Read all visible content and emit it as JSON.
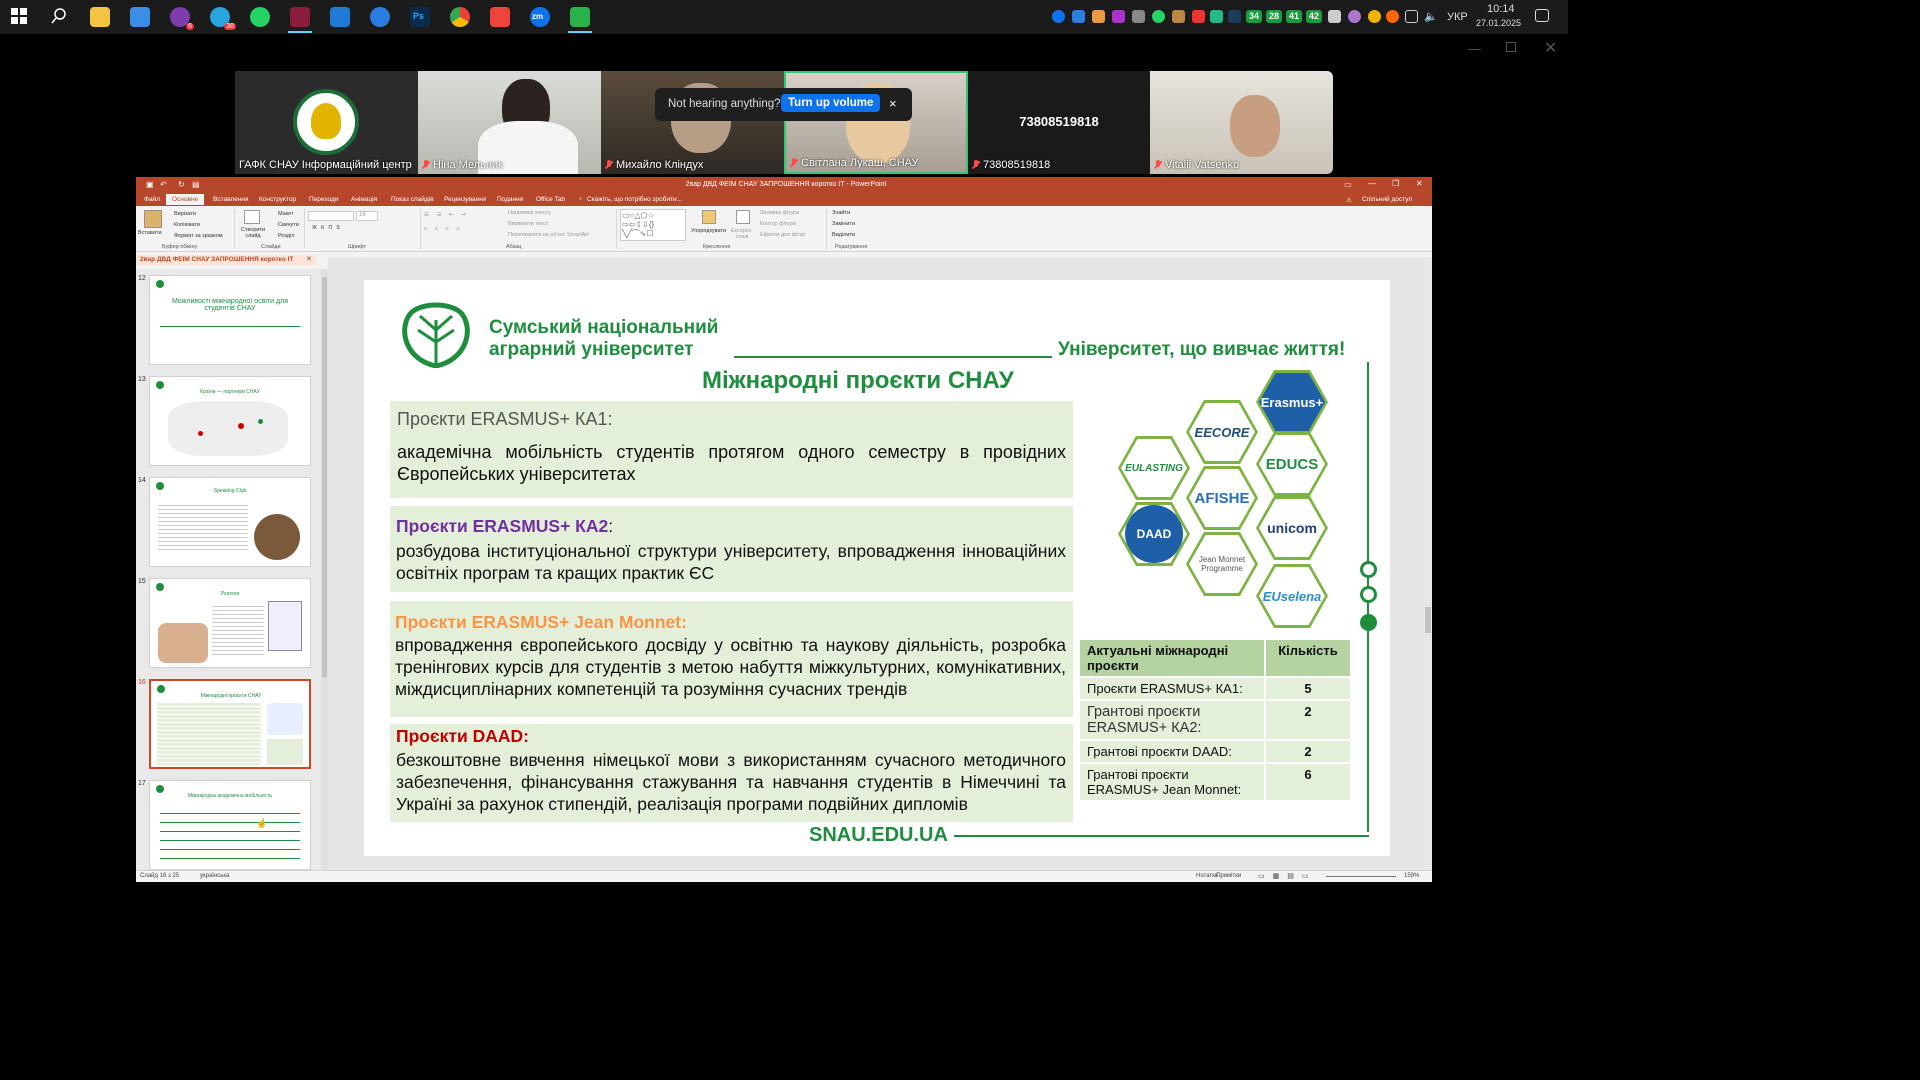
{
  "taskbar": {
    "icons": [
      "windows-icon",
      "search-icon",
      "file-explorer-icon",
      "microsoft-store-icon",
      "viber-icon",
      "telegram-icon",
      "whatsapp-icon",
      "app-icon",
      "vscode-icon",
      "firefox-icon",
      "photoshop-icon",
      "chrome-icon",
      "anydesk-icon",
      "zoom-icon",
      "app-green-icon"
    ],
    "badges": {
      "viber": "6",
      "telegram": "38"
    },
    "tray_numbers": [
      "34",
      "28",
      "41",
      "42"
    ],
    "language": "УКР",
    "time": "10:14",
    "date": "27.01.2025"
  },
  "zoom": {
    "participants": [
      {
        "name": "ГАФК СНАУ Інформаційний центр",
        "muted": false
      },
      {
        "name": "Ніна Мельник",
        "muted": true
      },
      {
        "name": "Михайло Кліндух",
        "muted": true
      },
      {
        "name": "Світлана Лукаш, СНАУ",
        "muted": true,
        "active": true
      },
      {
        "name": "73808519818",
        "muted": true,
        "big_label": "73808519818"
      },
      {
        "name": "Vitalii Vatsenko",
        "muted": true
      }
    ],
    "toast": {
      "text": "Not hearing anything?",
      "button": "Turn up volume",
      "close": "×"
    }
  },
  "ppt": {
    "title": "2вар ДВД ФЕІМ СНАУ ЗАПРОШЕННЯ коротко IT  -  PowerPoint",
    "tabs": [
      "Файл",
      "Основне",
      "Вставлення",
      "Конструктор",
      "Переходи",
      "Анімація",
      "Показ слайдів",
      "Рецензування",
      "Подання",
      "Office Tab"
    ],
    "tell_me": "Скажіть, що потрібно зробити...",
    "share": "Спільний доступ",
    "ribbon": {
      "paste": "Вставити",
      "cut": "Вирізати",
      "copy": "Копіювати",
      "format_painter": "Формат за зразком",
      "clipboard": "Буфер обміну",
      "new_slide": "Створити слайд",
      "layout": "Макет",
      "reset": "Скинути",
      "section": "Розділ",
      "slides": "Слайди",
      "font_size": "16",
      "font_group": "Шрифт",
      "text_direction": "Напрямок тексту",
      "align_text": "Вирівняти текст",
      "smartart": "Перетворити на об'єкт SmartArt",
      "paragraph": "Абзац",
      "arrange": "Упорядкувати",
      "quick_styles": "Експрес-стилі",
      "fill": "Заливка фігури",
      "outline": "Контур фігури",
      "effects": "Ефекти для фігур",
      "drawing": "Креслення",
      "find": "Знайти",
      "replace": "Замінити",
      "select": "Виділити",
      "editing": "Редагування"
    },
    "doc_tab": "2вар ДВД ФЕІМ СНАУ ЗАПРОШЕННЯ коротко IT",
    "thumbnails": [
      {
        "num": "12",
        "title": "Можливості міжнародної освіти для студентів СНАУ"
      },
      {
        "num": "13",
        "title": "Країни — партнери СНАУ"
      },
      {
        "num": "14",
        "title": "Speaking Club"
      },
      {
        "num": "15",
        "title": "Pearson"
      },
      {
        "num": "16",
        "title": "Міжнародні  проєкти СНАУ"
      },
      {
        "num": "17",
        "title": "Міжнародна академічна мобільність"
      }
    ],
    "selected_thumb": "16",
    "status": {
      "slide": "Слайд 16 з 25",
      "lang": "українська",
      "notes": "Нотатки",
      "comments": "Примітки",
      "zoom": "159%"
    }
  },
  "slide": {
    "uni_name_1": "Сумський національний",
    "uni_name_2": "аграрний університет",
    "slogan": "Університет, що вивчає життя!",
    "title": "Міжнародні  проєкти СНАУ",
    "blocks": [
      {
        "head": "Проєкти ERASMUS+ КА1:",
        "body": "академічна мобільність студентів протягом одного семестру в провідних Європейських університетах",
        "color": "#555555"
      },
      {
        "head": "Проєкти ERASMUS+ КА2",
        "head_suffix": ":",
        "body": "розбудова інституціональної структури університету, впровадження інноваційних освітніх програм та кращих практик ЄС",
        "color": "#7030a0"
      },
      {
        "head": "Проєкти ERASMUS+ Jean Monnet:",
        "body": "впровадження європейського досвіду у освітню та наукову діяльність, розробка тренінгових курсів для студентів з метою набуття міжкультурних, комунікативних, міждисциплінарних компетенцій та розуміння сучасних трендів",
        "color": "#f79646"
      },
      {
        "head": "Проєкти DAAD:",
        "body": "безкоштовне вивчення німецької мови з використанням сучасного методичного забезпечення, фінансування стажування та навчання студентів в Німеччині та Україні за рахунок стипендій, реалізація програми подвійних дипломів",
        "color": "#c00000"
      }
    ],
    "logos": [
      "Erasmus+",
      "EECORE",
      "EDUCS",
      "EULASTING",
      "AFISHE",
      "DAAD",
      "unicom",
      "Jean Monnet Programme",
      "EUselena"
    ],
    "table": {
      "headers": [
        "Актуальні міжнародні проєкти",
        "Кількість"
      ],
      "rows": [
        [
          "Проєкти ERASMUS+ КА1:",
          "5"
        ],
        [
          "Грантові проєкти ERASMUS+ КА2:",
          "2"
        ],
        [
          "Грантові проєкти DAAD:",
          "2"
        ],
        [
          "Грантові проєкти ERASMUS+ Jean Monnet:",
          "6"
        ]
      ]
    },
    "website": "SNAU.EDU.UA"
  },
  "colors": {
    "accent_green": "#1e8e3e",
    "ppt_red": "#b7472a",
    "box_green": "#e3efd9",
    "zoom_blue": "#0e72ed"
  }
}
